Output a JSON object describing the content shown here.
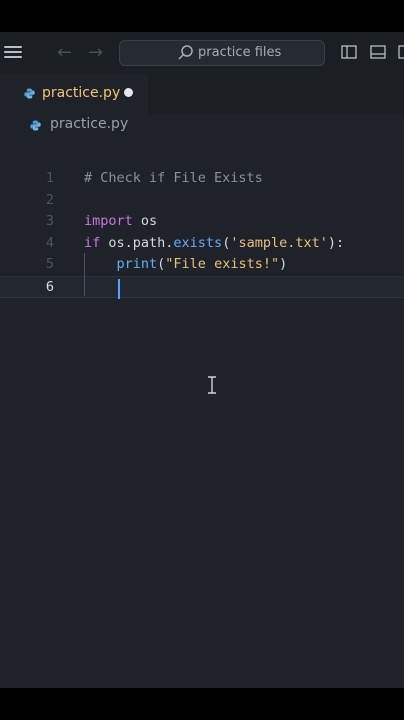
{
  "titlebar": {
    "search_label": "practice files",
    "icons": [
      "menu-icon",
      "back-arrow-icon",
      "forward-arrow-icon",
      "search-icon",
      "split-editor-icon",
      "toggle-panel-icon"
    ]
  },
  "tab": {
    "label": "practice.py",
    "modified": true
  },
  "breadcrumb": {
    "file": "practice.py"
  },
  "editor": {
    "current_line": 6,
    "lines": [
      {
        "num": "1",
        "tokens": [
          {
            "t": "comment",
            "v": "# Check if File Exists"
          }
        ]
      },
      {
        "num": "2",
        "tokens": []
      },
      {
        "num": "3",
        "tokens": [
          {
            "t": "kw",
            "v": "import"
          },
          {
            "t": "plain",
            "v": " os"
          }
        ]
      },
      {
        "num": "4",
        "tokens": [
          {
            "t": "kw",
            "v": "if"
          },
          {
            "t": "plain",
            "v": " os.path."
          },
          {
            "t": "fn",
            "v": "exists"
          },
          {
            "t": "plain",
            "v": "("
          },
          {
            "t": "str",
            "v": "'sample.txt'"
          },
          {
            "t": "plain",
            "v": "):"
          }
        ]
      },
      {
        "num": "5",
        "tokens": [
          {
            "t": "plain",
            "v": "    "
          },
          {
            "t": "fn",
            "v": "print"
          },
          {
            "t": "plain",
            "v": "("
          },
          {
            "t": "str",
            "v": "\"File exists!\""
          },
          {
            "t": "plain",
            "v": ")"
          }
        ]
      },
      {
        "num": "6",
        "tokens": []
      }
    ]
  },
  "colors": {
    "background": "#1f2329",
    "keyword": "#c678dd",
    "function": "#61afef",
    "string": "#e5c07b",
    "comment": "#8b9099",
    "tab_label": "#f0c674",
    "caret": "#5aa0ff"
  }
}
